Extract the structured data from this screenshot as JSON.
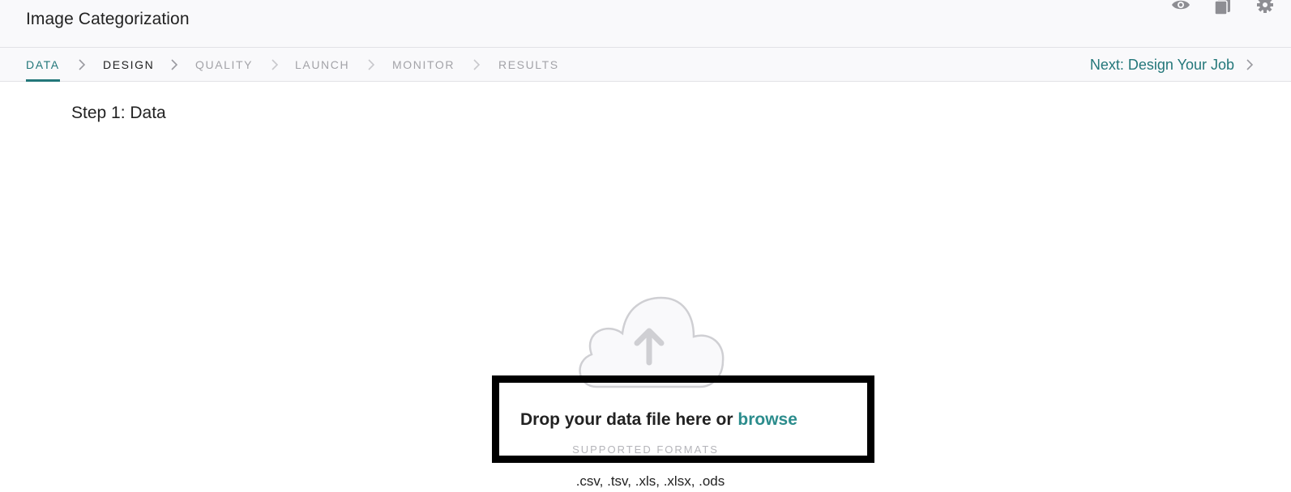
{
  "header": {
    "title": "Image Categorization",
    "icons": [
      "eye-icon",
      "copy-icon",
      "gear-icon"
    ]
  },
  "steps": [
    {
      "label": "DATA",
      "state": "active"
    },
    {
      "label": "DESIGN",
      "state": "current"
    },
    {
      "label": "QUALITY",
      "state": "inactive"
    },
    {
      "label": "LAUNCH",
      "state": "inactive"
    },
    {
      "label": "MONITOR",
      "state": "inactive"
    },
    {
      "label": "RESULTS",
      "state": "inactive"
    }
  ],
  "next_link": "Next: Design Your Job",
  "main": {
    "heading": "Step 1: Data",
    "drop_text": "Drop your data file here or ",
    "browse_label": "browse",
    "formats_label": "SUPPORTED FORMATS",
    "formats": ".csv, .tsv, .xls, .xlsx, .ods",
    "upload_icon": "cloud-upload-icon"
  },
  "colors": {
    "accent": "#23777a",
    "link": "#2b8c8c",
    "header_bg": "#f9f9fb",
    "inactive_step": "#a3a3a8",
    "icon_gray": "#8e8e93"
  }
}
